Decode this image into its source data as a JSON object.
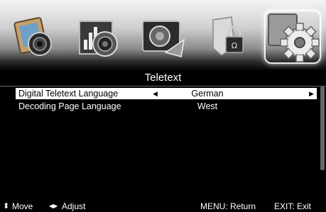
{
  "header": {
    "icons": [
      "picture-icon",
      "sound-icon",
      "channel-icon",
      "lock-icon",
      "settings-icon"
    ],
    "selected_icon": "settings-icon"
  },
  "menu": {
    "title": "Teletext",
    "items": [
      {
        "label": "Digital Teletext Language",
        "value": "German",
        "selected": true
      },
      {
        "label": "Decoding Page Language",
        "value": "West",
        "selected": false
      }
    ]
  },
  "footer": {
    "move_label": "Move",
    "adjust_label": "Adjust",
    "return_label": "MENU: Return",
    "exit_label": "EXIT: Exit"
  },
  "colors": {
    "background": "#000000",
    "highlight": "#ffffff",
    "text": "#ffffff"
  }
}
